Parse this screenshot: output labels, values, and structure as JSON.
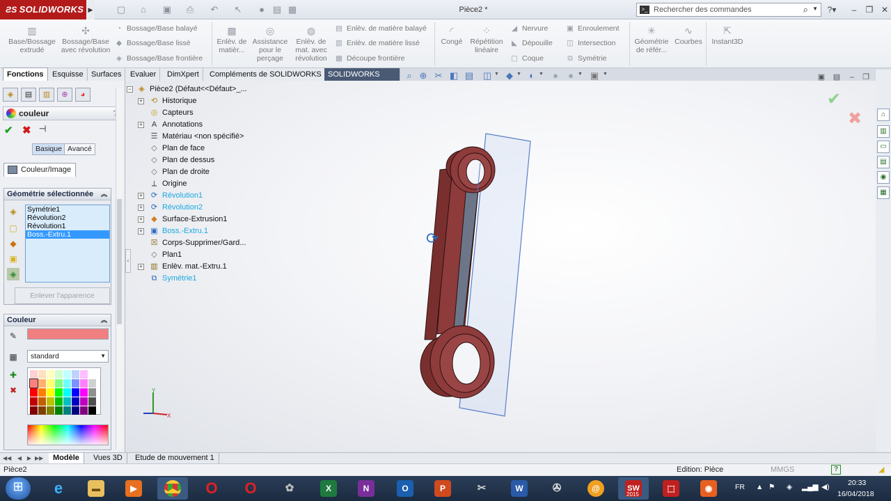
{
  "app": {
    "logo": "SOLIDWORKS",
    "document_title": "Pièce2 *",
    "command_search_placeholder": "Rechercher des commandes"
  },
  "ribbon": {
    "groups": [
      {
        "label": "Base/Bossage extrudé"
      },
      {
        "label": "Bossage/Base avec révolution"
      },
      {
        "label": "Bossage/Base balayé"
      },
      {
        "label": "Bossage/Base lissé"
      },
      {
        "label": "Bossage/Base frontière"
      },
      {
        "label": "Enlèv. de matièr..."
      },
      {
        "label": "Assistance pour le perçage"
      },
      {
        "label": "Enlèv. de mat. avec révolution"
      },
      {
        "label": "Enlèv. de matière balayé"
      },
      {
        "label": "Enlèv. de matière lissé"
      },
      {
        "label": "Découpe frontière"
      },
      {
        "label": "Congé"
      },
      {
        "label": "Répétition linéaire"
      },
      {
        "label": "Nervure"
      },
      {
        "label": "Dépouille"
      },
      {
        "label": "Coque"
      },
      {
        "label": "Enroulement"
      },
      {
        "label": "Intersection"
      },
      {
        "label": "Symétrie"
      },
      {
        "label": "Géométrie de référ..."
      },
      {
        "label": "Courbes"
      },
      {
        "label": "Instant3D"
      }
    ]
  },
  "tabs": [
    "Fonctions",
    "Esquisse",
    "Surfaces",
    "Evaluer",
    "DimXpert",
    "Compléments de SOLIDWORKS",
    "SOLIDWORKS MBD"
  ],
  "property_manager": {
    "title": "couleur",
    "help": "?",
    "mode_basic": "Basique",
    "mode_advanced": "Avancé",
    "tab_label": "Couleur/Image",
    "selected_geometry": {
      "title": "Géométrie sélectionnée",
      "items": [
        "Symétrie1",
        "Révolution2",
        "Révolution1",
        "Boss.-Extru.1"
      ],
      "selected_index": 3,
      "remove_button": "Enlever l'apparence"
    },
    "color": {
      "title": "Couleur",
      "current_color": "#f08080",
      "palette_name": "standard"
    }
  },
  "feature_tree": {
    "root": "Pièce2  (Défaut<<Défaut>_...",
    "items": [
      {
        "label": "Historique",
        "icon": "history-icon",
        "expandable": true,
        "highlight": false
      },
      {
        "label": "Capteurs",
        "icon": "sensor-icon",
        "expandable": false,
        "highlight": false
      },
      {
        "label": "Annotations",
        "icon": "annotation-icon",
        "expandable": true,
        "highlight": false
      },
      {
        "label": "Matériau <non spécifié>",
        "icon": "material-icon",
        "expandable": false,
        "highlight": false
      },
      {
        "label": "Plan de face",
        "icon": "plane-icon",
        "expandable": false,
        "highlight": false
      },
      {
        "label": "Plan de dessus",
        "icon": "plane-icon",
        "expandable": false,
        "highlight": false
      },
      {
        "label": "Plan de droite",
        "icon": "plane-icon",
        "expandable": false,
        "highlight": false
      },
      {
        "label": "Origine",
        "icon": "origin-icon",
        "expandable": false,
        "highlight": false
      },
      {
        "label": "Révolution1",
        "icon": "revolve-icon",
        "expandable": true,
        "highlight": true
      },
      {
        "label": "Révolution2",
        "icon": "revolve-icon",
        "expandable": true,
        "highlight": true
      },
      {
        "label": "Surface-Extrusion1",
        "icon": "surface-extrude-icon",
        "expandable": true,
        "highlight": false
      },
      {
        "label": "Boss.-Extru.1",
        "icon": "extrude-icon",
        "expandable": true,
        "highlight": true
      },
      {
        "label": "Corps-Supprimer/Gard...",
        "icon": "delete-body-icon",
        "expandable": false,
        "highlight": false
      },
      {
        "label": "Plan1",
        "icon": "plane-icon",
        "expandable": false,
        "highlight": false
      },
      {
        "label": "Enlèv. mat.-Extru.1",
        "icon": "cut-extrude-icon",
        "expandable": true,
        "highlight": false
      },
      {
        "label": "Symétrie1",
        "icon": "mirror-icon",
        "expandable": false,
        "highlight": true
      }
    ]
  },
  "bottom_tabs": [
    "Modèle",
    "Vues 3D",
    "Etude de mouvement 1"
  ],
  "status": {
    "left": "Pièce2",
    "edition": "Edition: Pièce",
    "units": "MMGS"
  },
  "taskbar": {
    "language": "FR",
    "time": "20:33",
    "date": "16/04/2018",
    "sw_badge": "2015"
  },
  "colors": {
    "part_body": "#8b3a3a",
    "accent_red": "#b31b1b",
    "highlight_blue": "#1aa8e0"
  }
}
